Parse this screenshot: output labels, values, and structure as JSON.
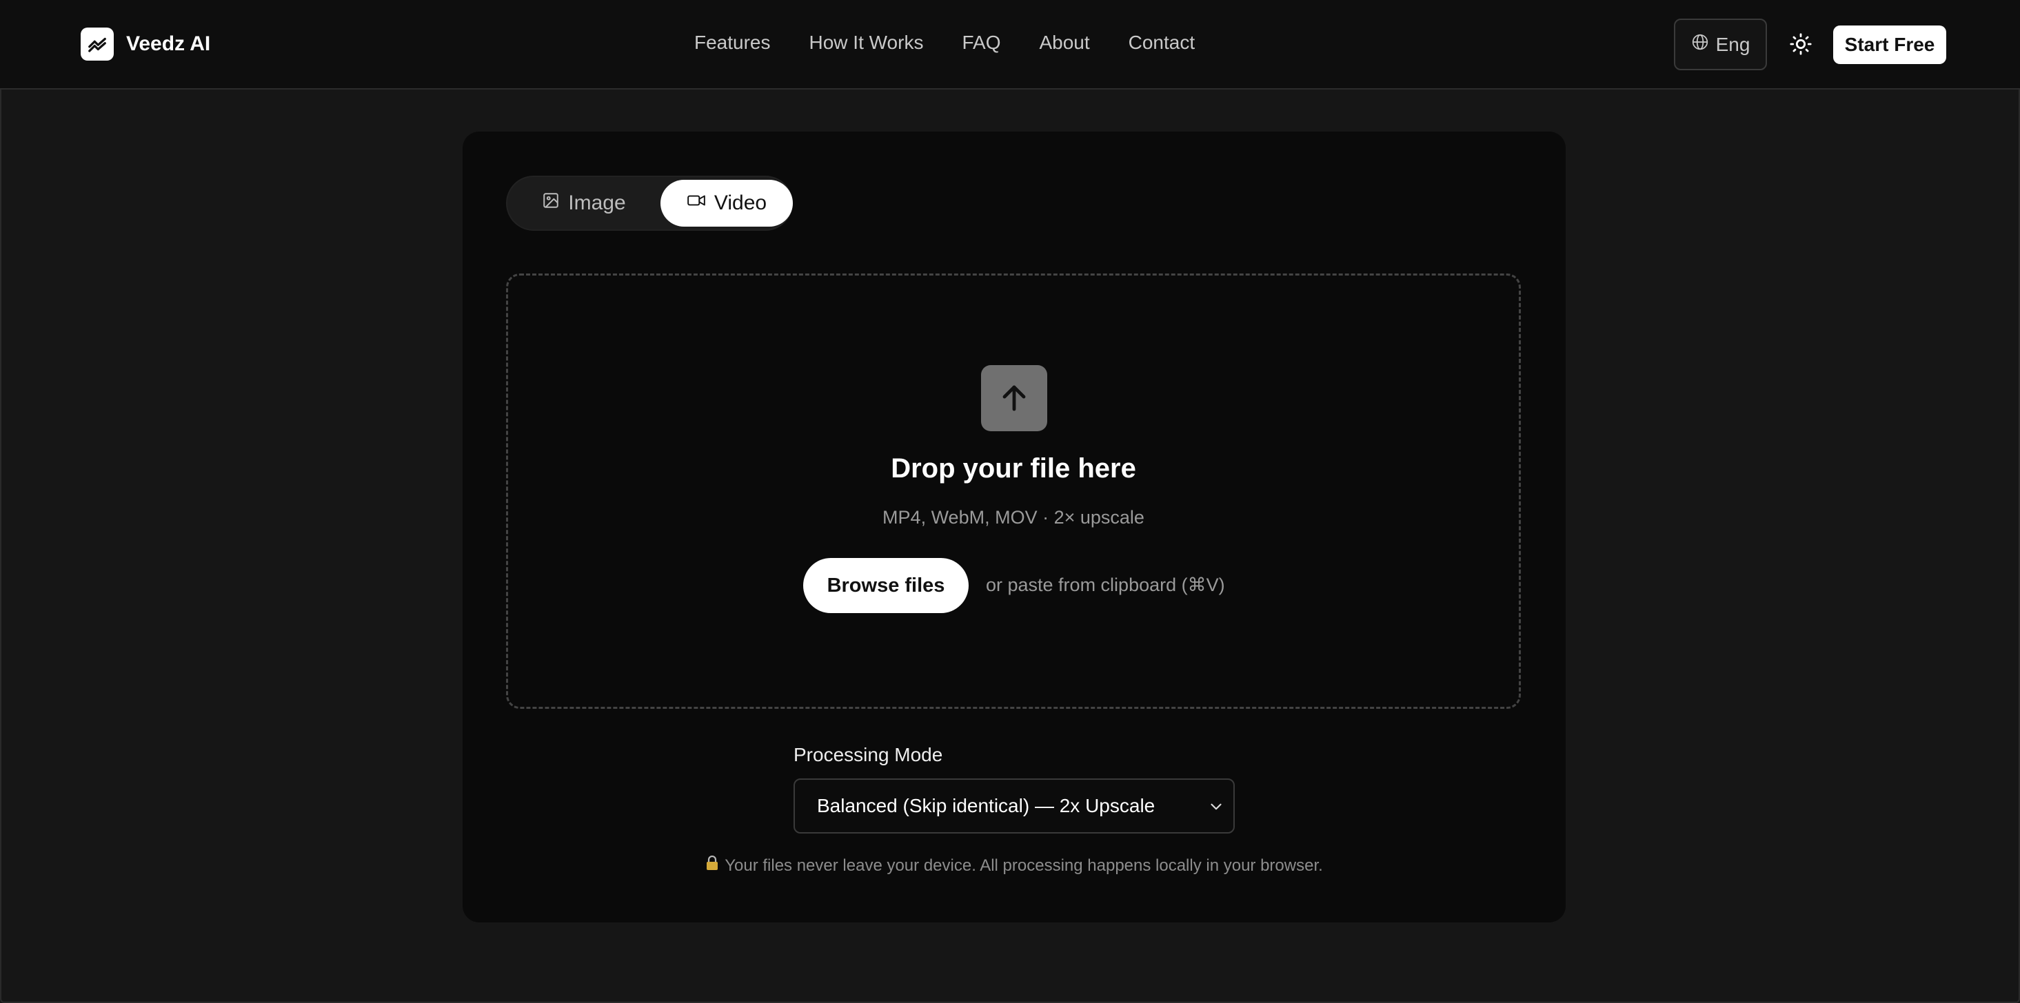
{
  "header": {
    "brand": "Veedz AI",
    "nav": [
      "Features",
      "How It Works",
      "FAQ",
      "About",
      "Contact"
    ],
    "language": "Eng",
    "cta": "Start Free"
  },
  "upload": {
    "tabs": {
      "image": "Image",
      "video": "Video",
      "active": "video"
    },
    "title": "Drop your file here",
    "formats": "MP4, WebM, MOV · 2× upscale",
    "browse": "Browse files",
    "paste_hint": "or paste from clipboard (⌘V)"
  },
  "processing": {
    "label": "Processing Mode",
    "selected": "Balanced (Skip identical) — 2x Upscale"
  },
  "privacy_note": "Your files never leave your device. All processing happens locally in your browser.",
  "icons": {
    "logo": "trend-chart-icon",
    "language": "globe-icon",
    "theme": "sun-icon",
    "image_tab": "image-icon",
    "video_tab": "video-camera-icon",
    "upload": "arrow-up-icon",
    "select": "chevron-down-icon",
    "privacy": "lock-icon"
  },
  "colors": {
    "background": "#161616",
    "header": "#0e0e0e",
    "card": "#0a0a0a",
    "accent": "#ffffff"
  }
}
